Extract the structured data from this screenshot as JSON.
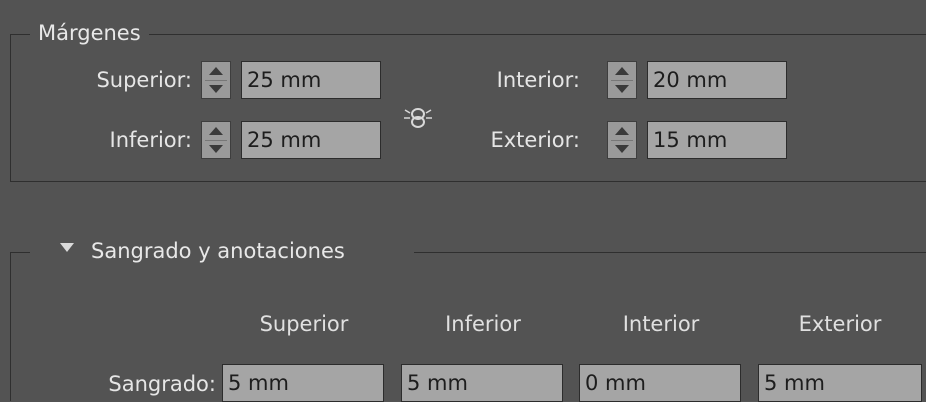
{
  "margenes": {
    "legend": "Márgenes",
    "superior": {
      "label": "Superior:",
      "value": "25 mm"
    },
    "inferior": {
      "label": "Inferior:",
      "value": "25 mm"
    },
    "interior": {
      "label": "Interior:",
      "value": "20 mm"
    },
    "exterior": {
      "label": "Exterior:",
      "value": "15 mm"
    }
  },
  "sangrado": {
    "legend": "Sangrado y anotaciones",
    "columns": [
      "Superior",
      "Inferior",
      "Interior",
      "Exterior"
    ],
    "row_label": "Sangrado:",
    "values": [
      "5 mm",
      "5 mm",
      "0 mm",
      "5 mm"
    ]
  },
  "icons": {
    "link": "chain-link-icon",
    "disclosure": "triangle-down-icon"
  }
}
